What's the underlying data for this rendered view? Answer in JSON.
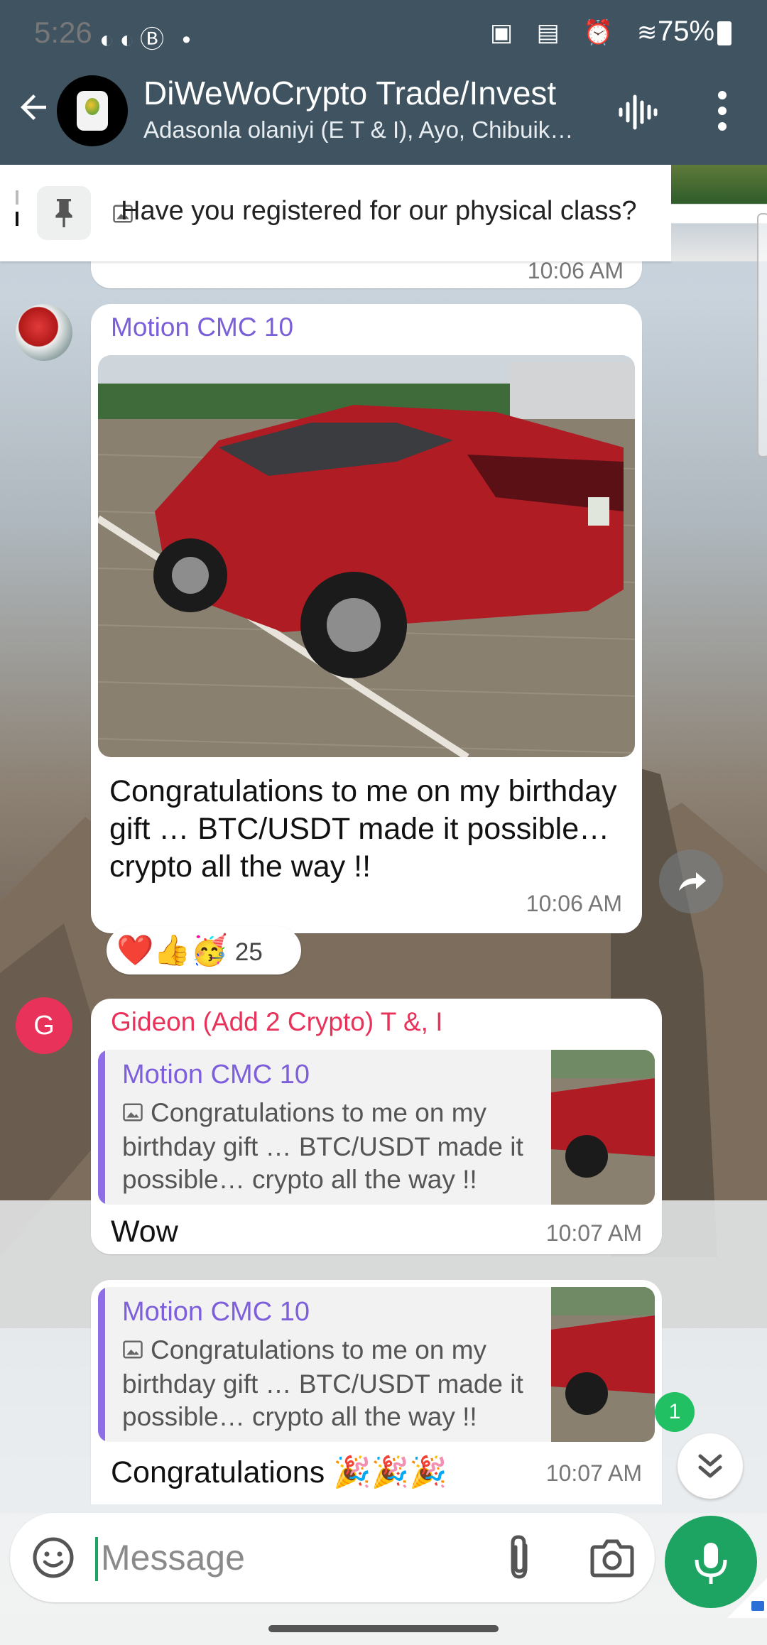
{
  "status_bar": {
    "time": "5:26",
    "left_icons": "◐◐Ⓑ •",
    "right_icons": "▣ ▤ ⏰ ≋",
    "battery": "75%"
  },
  "header": {
    "title": "DiWeWoCrypto Trade/Invest",
    "subtitle": "Adasonla olaniyi (E T & I), Ayo, Chibuike (T & I), Gideon"
  },
  "pinned": {
    "text": "Have you registered for our physical class?"
  },
  "messages": {
    "previous_time": "10:06 AM",
    "m1": {
      "sender": "Motion CMC 10",
      "sender_color": "#7b5fd9",
      "caption": "Congratulations to me on my birthday gift … BTC/USDT made it possible… crypto all the way !!",
      "time": "10:06 AM",
      "reactions": "❤️👍🥳",
      "reaction_count": "25"
    },
    "m2": {
      "avatar_letter": "G",
      "sender": "Gideon (Add 2 Crypto) T &, I",
      "sender_color": "#e8325a",
      "quote_name": "Motion CMC 10",
      "quote_text": "Congratulations to me on my birthday gift … BTC/USDT made it possible… crypto all the way !!",
      "text": "Wow",
      "time": "10:07 AM"
    },
    "m3": {
      "quote_name": "Motion CMC 10",
      "quote_text": "Congratulations to me on my birthday gift … BTC/USDT made it possible… crypto all the way !!",
      "text": "Congratulations 🎉🎉🎉",
      "time": "10:07 AM"
    }
  },
  "unread_count": "1",
  "composer": {
    "placeholder": "Message"
  },
  "icons": [
    "arrow-back-icon",
    "voice-call-icon",
    "more-menu-icon",
    "pin-icon",
    "image-icon",
    "forward-icon",
    "chevron-double-down-icon",
    "emoji-icon",
    "attach-icon",
    "camera-icon",
    "mic-icon"
  ],
  "colors": {
    "header": "#3f5361",
    "accent": "#1da463"
  }
}
